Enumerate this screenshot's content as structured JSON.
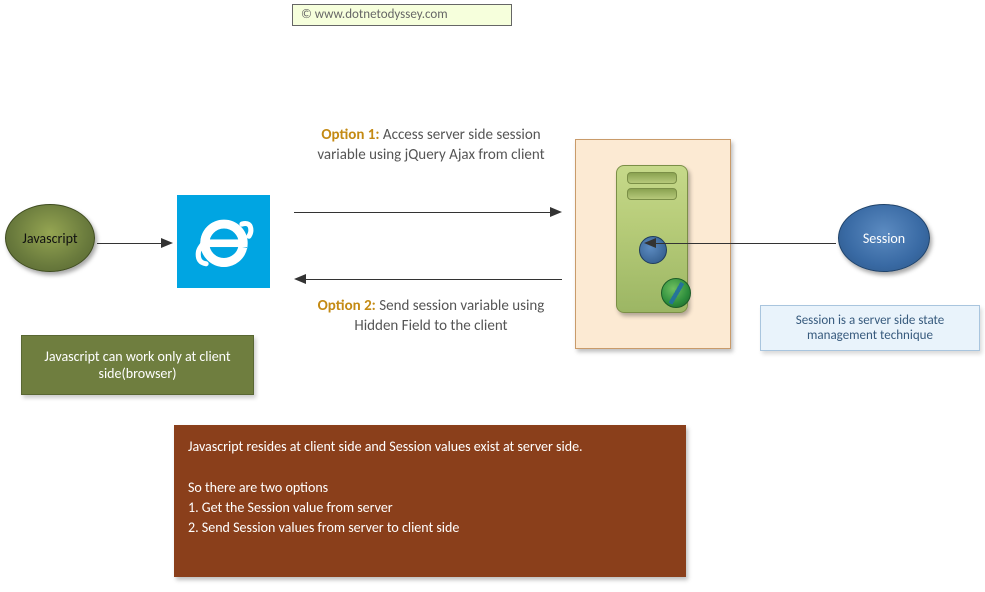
{
  "attribution": "©  www.dotnetodyssey.com",
  "nodes": {
    "javascript": "Javascript",
    "session": "Session"
  },
  "captions": {
    "js": "Javascript can work only at client side(browser)",
    "session": "Session is a server side state management technique"
  },
  "options": {
    "opt1": {
      "lead": "Option 1:",
      "text": " Access server side session variable using jQuery Ajax from client"
    },
    "opt2": {
      "lead": "Option 2:",
      "text": " Send session variable using Hidden Field to the client"
    }
  },
  "note": {
    "l1": "Javascript resides at client side and Session values exist at server side.",
    "l2": " So there are two options",
    "l3": "1. Get the Session value from server",
    "l4": "2. Send Session values from server to client side"
  },
  "colors": {
    "olive": "#6f7e3f",
    "blue": "#396aa4",
    "ie": "#00a5e2",
    "rust": "#8a3f1b",
    "peach": "#fcead3",
    "accent": "#c48a13"
  }
}
